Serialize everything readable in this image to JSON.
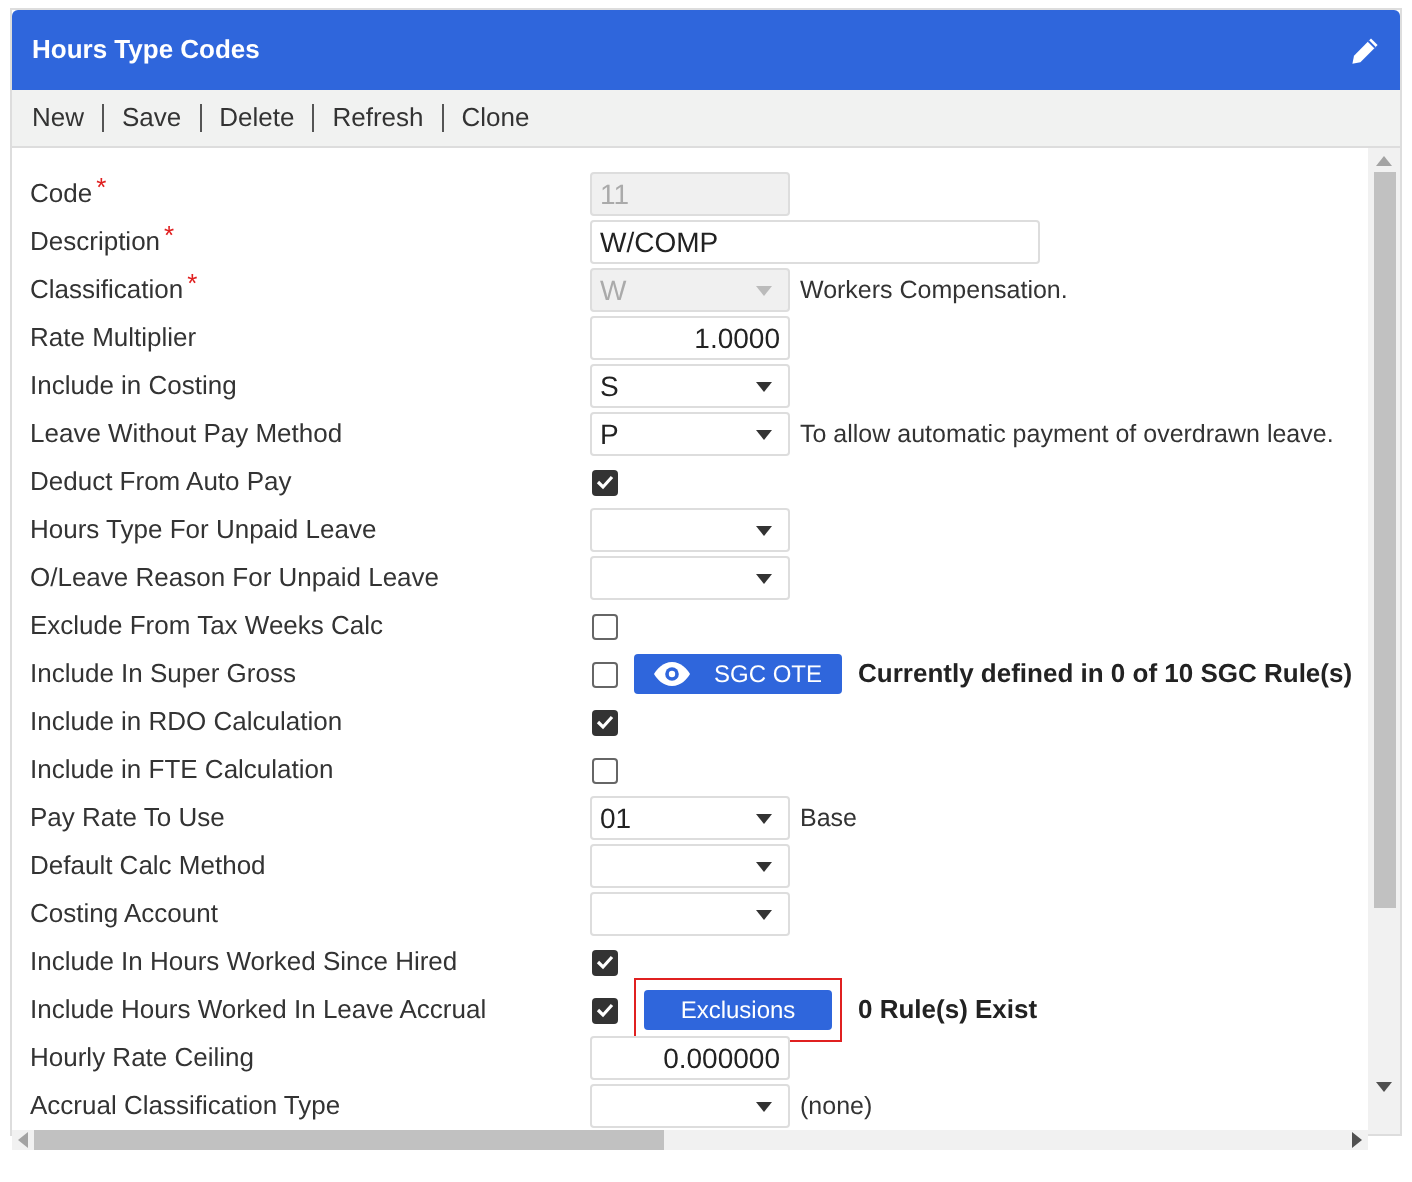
{
  "window": {
    "title": "Hours Type Codes"
  },
  "toolbar": [
    "New",
    "Save",
    "Delete",
    "Refresh",
    "Clone"
  ],
  "rows": [
    {
      "label": "Code",
      "required_mark": "*",
      "kind": "text",
      "value": "11",
      "disabled": true,
      "wide": false
    },
    {
      "label": "Description",
      "required_mark": "*",
      "kind": "text",
      "value": "W/COMP",
      "disabled": false,
      "wide": true
    },
    {
      "label": "Classification",
      "required_mark": "*",
      "kind": "select",
      "value": "W",
      "disabled": true,
      "note": "Workers Compensation."
    },
    {
      "label": "Rate Multiplier",
      "kind": "number",
      "value": "1.0000"
    },
    {
      "label": "Include in Costing",
      "kind": "select",
      "value": "S",
      "disabled": false
    },
    {
      "label": "Leave Without Pay Method",
      "kind": "select",
      "value": "P",
      "disabled": false,
      "note": "To allow automatic payment of overdrawn leave."
    },
    {
      "label": "Deduct From Auto Pay",
      "kind": "checkbox",
      "checked": true
    },
    {
      "label": "Hours Type For Unpaid Leave",
      "kind": "select",
      "disabled": false
    },
    {
      "label": "O/Leave Reason For Unpaid Leave",
      "kind": "select",
      "disabled": false
    },
    {
      "label": "Exclude From Tax Weeks Calc",
      "kind": "checkbox",
      "checked": false
    },
    {
      "label": "Include In Super Gross",
      "kind": "checkbox",
      "checked": false,
      "button": {
        "label": "SGC OTE",
        "kind": "view",
        "focused": false
      },
      "bold_note": "Currently defined in 0 of 10 SGC Rule(s)"
    },
    {
      "label": "Include in RDO Calculation",
      "kind": "checkbox",
      "checked": true
    },
    {
      "label": "Include in FTE Calculation",
      "kind": "checkbox",
      "checked": false
    },
    {
      "label": "Pay Rate To Use",
      "kind": "select",
      "value": "01",
      "disabled": false,
      "note": "Base"
    },
    {
      "label": "Default Calc Method",
      "kind": "select",
      "disabled": false
    },
    {
      "label": "Costing Account",
      "kind": "select",
      "disabled": false
    },
    {
      "label": "Include In Hours Worked Since Hired",
      "kind": "checkbox",
      "checked": true
    },
    {
      "label": "Include Hours Worked In Leave Accrual",
      "kind": "checkbox",
      "checked": true,
      "button": {
        "label": "Exclusions",
        "kind": "plain",
        "focused": true
      },
      "bold_note": "0 Rule(s) Exist"
    },
    {
      "label": "Hourly Rate Ceiling",
      "kind": "number",
      "value": "0.000000"
    },
    {
      "label": "Accrual Classification Type",
      "kind": "select",
      "disabled": false,
      "note": "(none)"
    }
  ]
}
